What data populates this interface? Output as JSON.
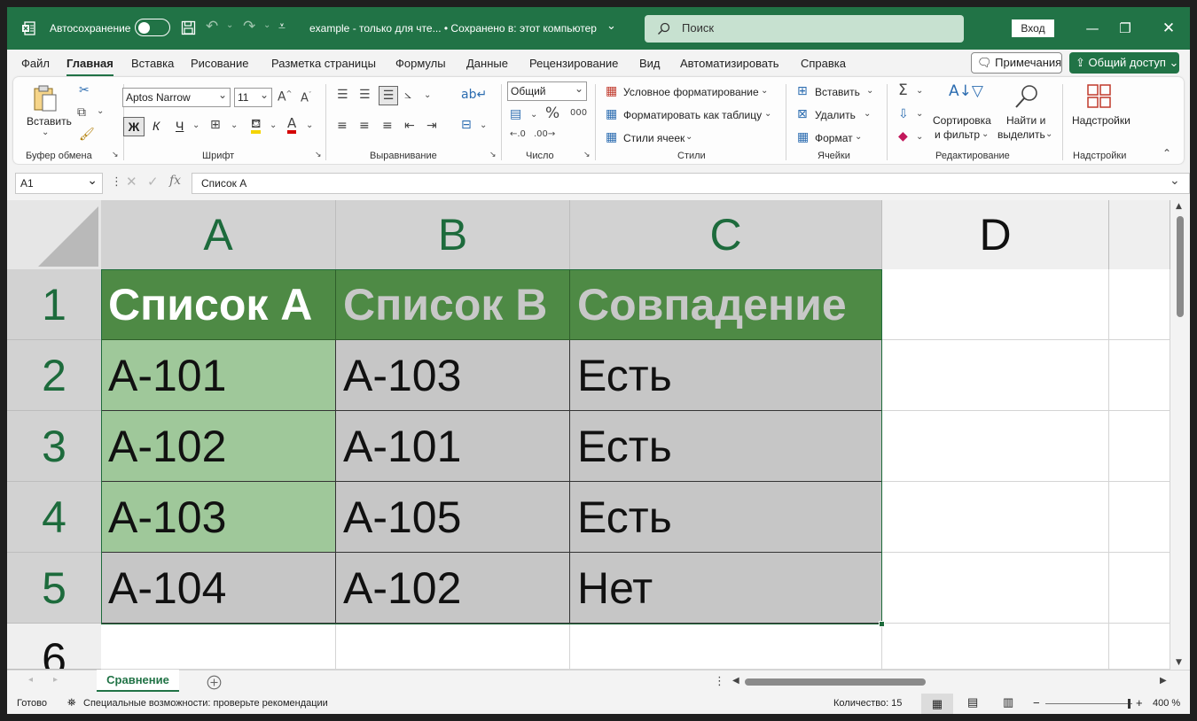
{
  "titlebar": {
    "autosave_label": "Автосохранение",
    "filename": "example  -  только для чте...  •  Сохранено в: этот компьютер",
    "search_placeholder": "Поиск",
    "login_label": "Вход"
  },
  "menu": {
    "tabs": [
      "Файл",
      "Главная",
      "Вставка",
      "Рисование",
      "Разметка страницы",
      "Формулы",
      "Данные",
      "Рецензирование",
      "Вид",
      "Автоматизировать",
      "Справка"
    ],
    "active_tab": "Главная",
    "notes_label": "Примечания",
    "share_label": "Общий доступ"
  },
  "ribbon": {
    "paste_label": "Вставить",
    "clipboard_group": "Буфер обмена",
    "font_name": "Aptos Narrow",
    "font_size": "11",
    "font_group": "Шрифт",
    "bold": "Ж",
    "italic": "К",
    "underline": "Ч",
    "alignment_group": "Выравнивание",
    "number_format": "Общий",
    "number_group": "Число",
    "conditional_formatting": "Условное форматирование",
    "format_as_table": "Форматировать как таблицу",
    "cell_styles": "Стили ячеек",
    "styles_group": "Стили",
    "insert_label": "Вставить",
    "delete_label": "Удалить",
    "format_label": "Формат",
    "cells_group": "Ячейки",
    "sort_label_1": "Сортировка",
    "sort_label_2": "и фильтр",
    "find_label_1": "Найти и",
    "find_label_2": "выделить",
    "editing_group": "Редактирование",
    "addins_label": "Надстройки",
    "addins_group": "Надстройки",
    "pct_symbol": "%",
    "thousands_symbol": "000"
  },
  "formula_bar": {
    "name_box": "A1",
    "fx": "fx",
    "value": "Список A"
  },
  "grid": {
    "columns": [
      "A",
      "B",
      "C",
      "D"
    ],
    "rows": [
      "1",
      "2",
      "3",
      "4",
      "5",
      "6"
    ],
    "header": [
      "Список A",
      "Список B",
      "Совпадение"
    ],
    "data": [
      [
        "A-101",
        "A-103",
        "Есть"
      ],
      [
        "A-102",
        "A-101",
        "Есть"
      ],
      [
        "A-103",
        "A-105",
        "Есть"
      ],
      [
        "A-104",
        "A-102",
        "Нет"
      ]
    ]
  },
  "sheets": {
    "active": "Сравнение"
  },
  "statusbar": {
    "ready": "Готово",
    "accessibility": "Специальные возможности: проверьте рекомендации",
    "count": "Количество: 15",
    "zoom": "400 %"
  }
}
